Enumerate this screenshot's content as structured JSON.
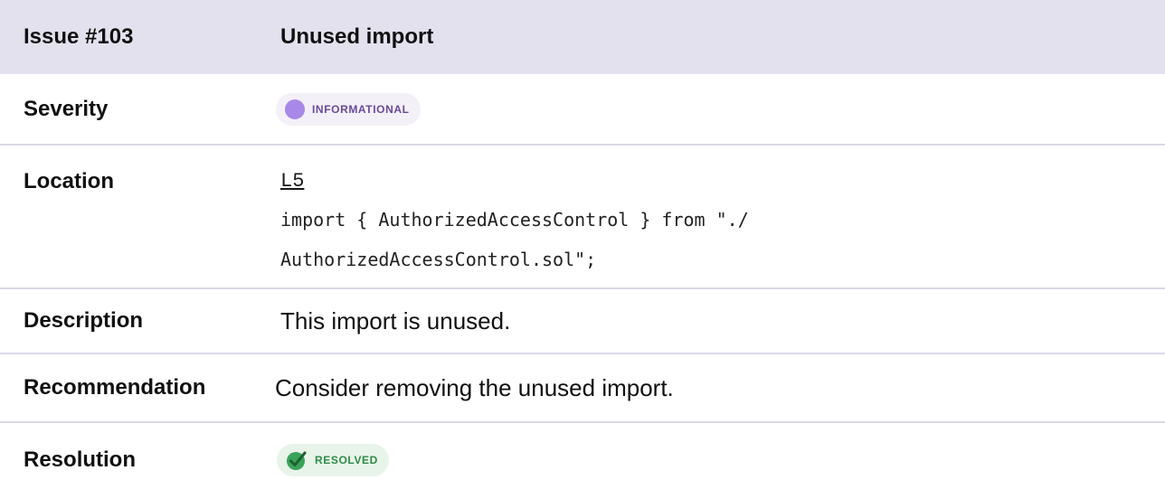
{
  "header": {
    "issue_label": "Issue #103",
    "title": "Unused import"
  },
  "severity": {
    "label": "Severity",
    "badge_text": "INFORMATIONAL",
    "dot_color": "#a888e8"
  },
  "location": {
    "label": "Location",
    "link_text": "L5",
    "code_line1": "import { AuthorizedAccessControl } from \"./",
    "code_line2": "AuthorizedAccessControl.sol\";"
  },
  "description": {
    "label": "Description",
    "text": "This import is unused."
  },
  "recommendation": {
    "label": "Recommendation",
    "text": "Consider removing the unused import."
  },
  "resolution": {
    "label": "Resolution",
    "badge_text": "RESOLVED",
    "icon": "check-circle-icon",
    "badge_color": "#3aa35a"
  },
  "colors": {
    "header_bg": "#e4e1ee",
    "divider": "#dcd8e6"
  }
}
